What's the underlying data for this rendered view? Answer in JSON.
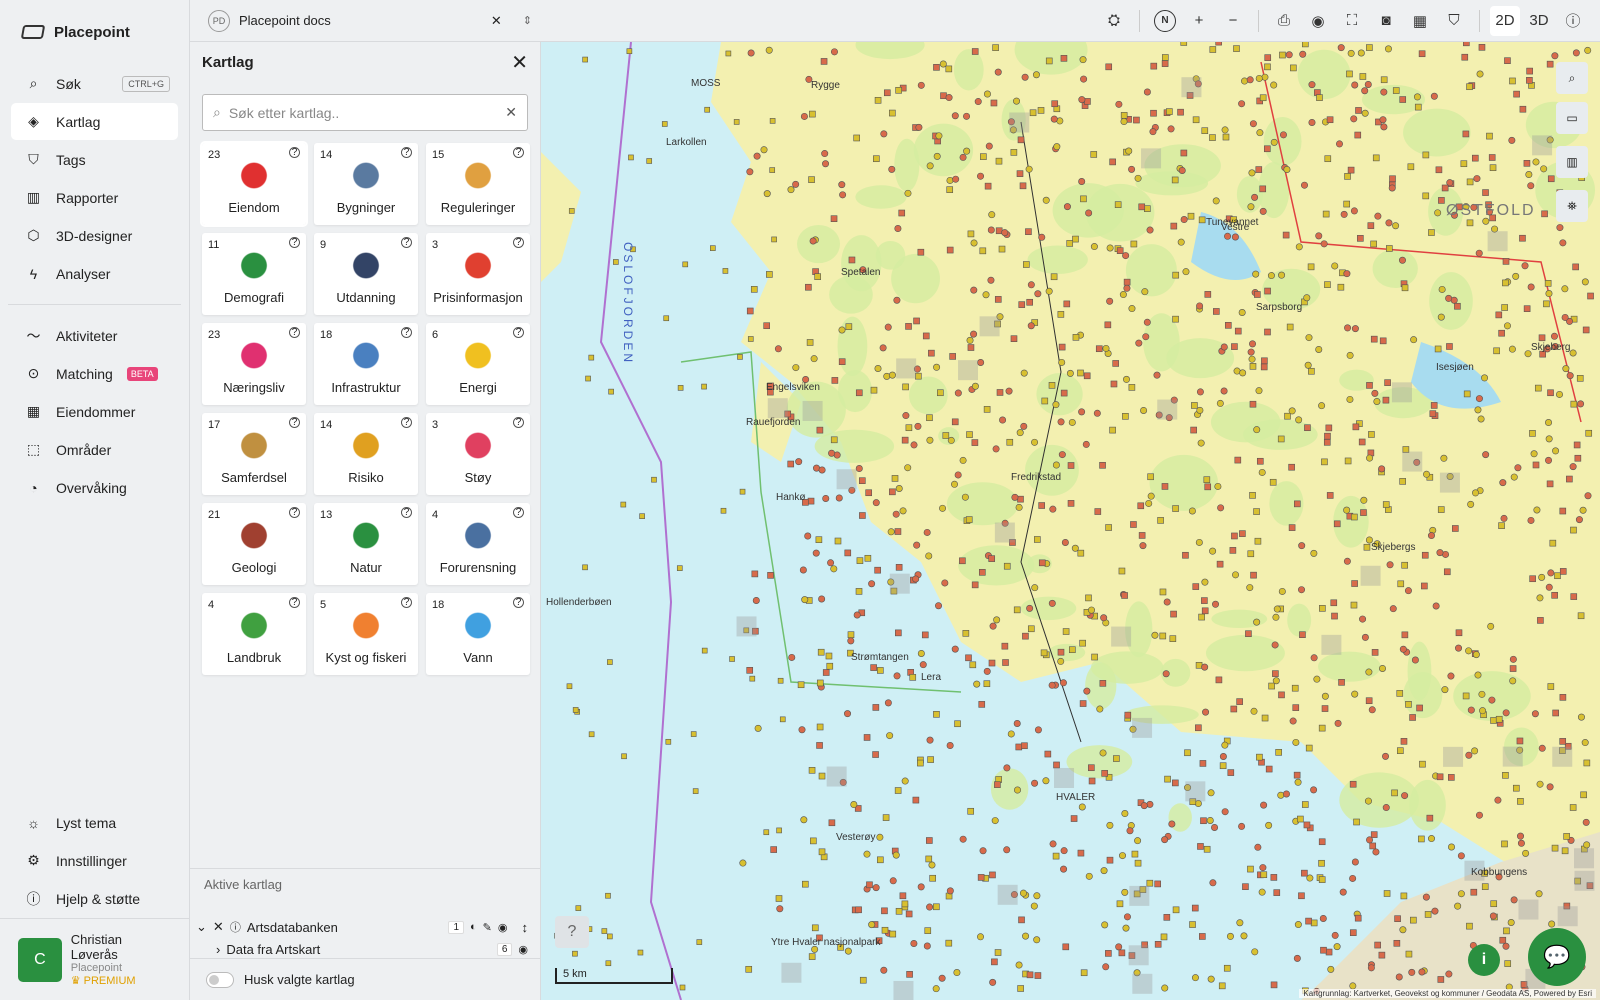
{
  "app": {
    "name": "Placepoint"
  },
  "nav": {
    "items": [
      {
        "label": "Søk",
        "icon": "search-icon",
        "shortcut": "CTRL+G"
      },
      {
        "label": "Kartlag",
        "icon": "layers-icon",
        "active": true
      },
      {
        "label": "Tags",
        "icon": "bookmark-icon"
      },
      {
        "label": "Rapporter",
        "icon": "report-icon"
      },
      {
        "label": "3D-designer",
        "icon": "cube-icon"
      },
      {
        "label": "Analyser",
        "icon": "bolt-icon"
      }
    ],
    "items2": [
      {
        "label": "Aktiviteter",
        "icon": "activity-icon"
      },
      {
        "label": "Matching",
        "icon": "match-icon",
        "badge": "BETA"
      },
      {
        "label": "Eiendommer",
        "icon": "building-icon"
      },
      {
        "label": "Områder",
        "icon": "area-icon"
      },
      {
        "label": "Overvåking",
        "icon": "monitor-icon"
      }
    ],
    "bottom": [
      {
        "label": "Lyst tema",
        "icon": "sun-icon"
      },
      {
        "label": "Innstillinger",
        "icon": "gear-icon"
      },
      {
        "label": "Hjelp & støtte",
        "icon": "help-icon"
      }
    ],
    "user": {
      "initial": "C",
      "name": "Christian Løverås",
      "org": "Placepoint",
      "plan": "PREMIUM"
    }
  },
  "topbar": {
    "badge": "PD",
    "project": "Placepoint docs",
    "compass": "N",
    "mode_2d": "2D",
    "mode_3d": "3D"
  },
  "panel": {
    "title": "Kartlag",
    "search_placeholder": "Søk etter kartlag..",
    "categories": [
      {
        "count": "23",
        "label": "Eiendom",
        "icon": "map-pin-icon",
        "color": "#e03030"
      },
      {
        "count": "14",
        "label": "Bygninger",
        "icon": "building-icon",
        "color": "#5a7aa0"
      },
      {
        "count": "15",
        "label": "Reguleringer",
        "icon": "signpost-icon",
        "color": "#e0a040"
      },
      {
        "count": "11",
        "label": "Demografi",
        "icon": "people-icon",
        "color": "#2a9040"
      },
      {
        "count": "9",
        "label": "Utdanning",
        "icon": "graduation-icon",
        "color": "#334466"
      },
      {
        "count": "3",
        "label": "Prisinformasjon",
        "icon": "shopping-bag-icon",
        "color": "#e04030"
      },
      {
        "count": "23",
        "label": "Næringsliv",
        "icon": "bag-icon",
        "color": "#e03070"
      },
      {
        "count": "18",
        "label": "Infrastruktur",
        "icon": "network-icon",
        "color": "#4a80c0"
      },
      {
        "count": "6",
        "label": "Energi",
        "icon": "lightning-icon",
        "color": "#f0c020"
      },
      {
        "count": "17",
        "label": "Samferdsel",
        "icon": "train-icon",
        "color": "#c09040"
      },
      {
        "count": "14",
        "label": "Risiko",
        "icon": "warning-icon",
        "color": "#e0a020"
      },
      {
        "count": "3",
        "label": "Støy",
        "icon": "gauge-icon",
        "color": "#e04060"
      },
      {
        "count": "21",
        "label": "Geologi",
        "icon": "terrain-icon",
        "color": "#a04030"
      },
      {
        "count": "13",
        "label": "Natur",
        "icon": "leaf-icon",
        "color": "#2a9040"
      },
      {
        "count": "4",
        "label": "Forurensning",
        "icon": "factory-icon",
        "color": "#4a70a0"
      },
      {
        "count": "4",
        "label": "Landbruk",
        "icon": "sprout-icon",
        "color": "#40a040"
      },
      {
        "count": "5",
        "label": "Kyst og fiskeri",
        "icon": "fish-icon",
        "color": "#f08030"
      },
      {
        "count": "18",
        "label": "Vann",
        "icon": "water-drop-icon",
        "color": "#40a0e0"
      }
    ],
    "active_title": "Aktive kartlag",
    "active_layer": {
      "name": "Artsdatabanken",
      "count": "1"
    },
    "sub_layer": {
      "name": "Data fra Artskart",
      "count": "6"
    },
    "remember_label": "Husk valgte kartlag"
  },
  "map": {
    "labels": [
      "MOSS",
      "Larkollen",
      "Rygge",
      "OSLOFJORDEN",
      "Spetalen",
      "Engelsviken",
      "Hankø",
      "Hollenderbøen",
      "Strømtangen",
      "Lera",
      "Vesterøy",
      "HVALER",
      "Sarpsborg",
      "Fredrikstad",
      "Isesjøen",
      "Skjeberg",
      "Tunevannet",
      "ØSTFOLD",
      "Ytre Hvaler nasjonalpark",
      "Kobbungens",
      "Rauefjorden",
      "Skjebergs",
      "Vestre"
    ],
    "scale": "5 km",
    "attribution": "Kartgrunnlag: Kartverket, Geovekst og kommuner / Geodata AS, Powered by Esri"
  }
}
